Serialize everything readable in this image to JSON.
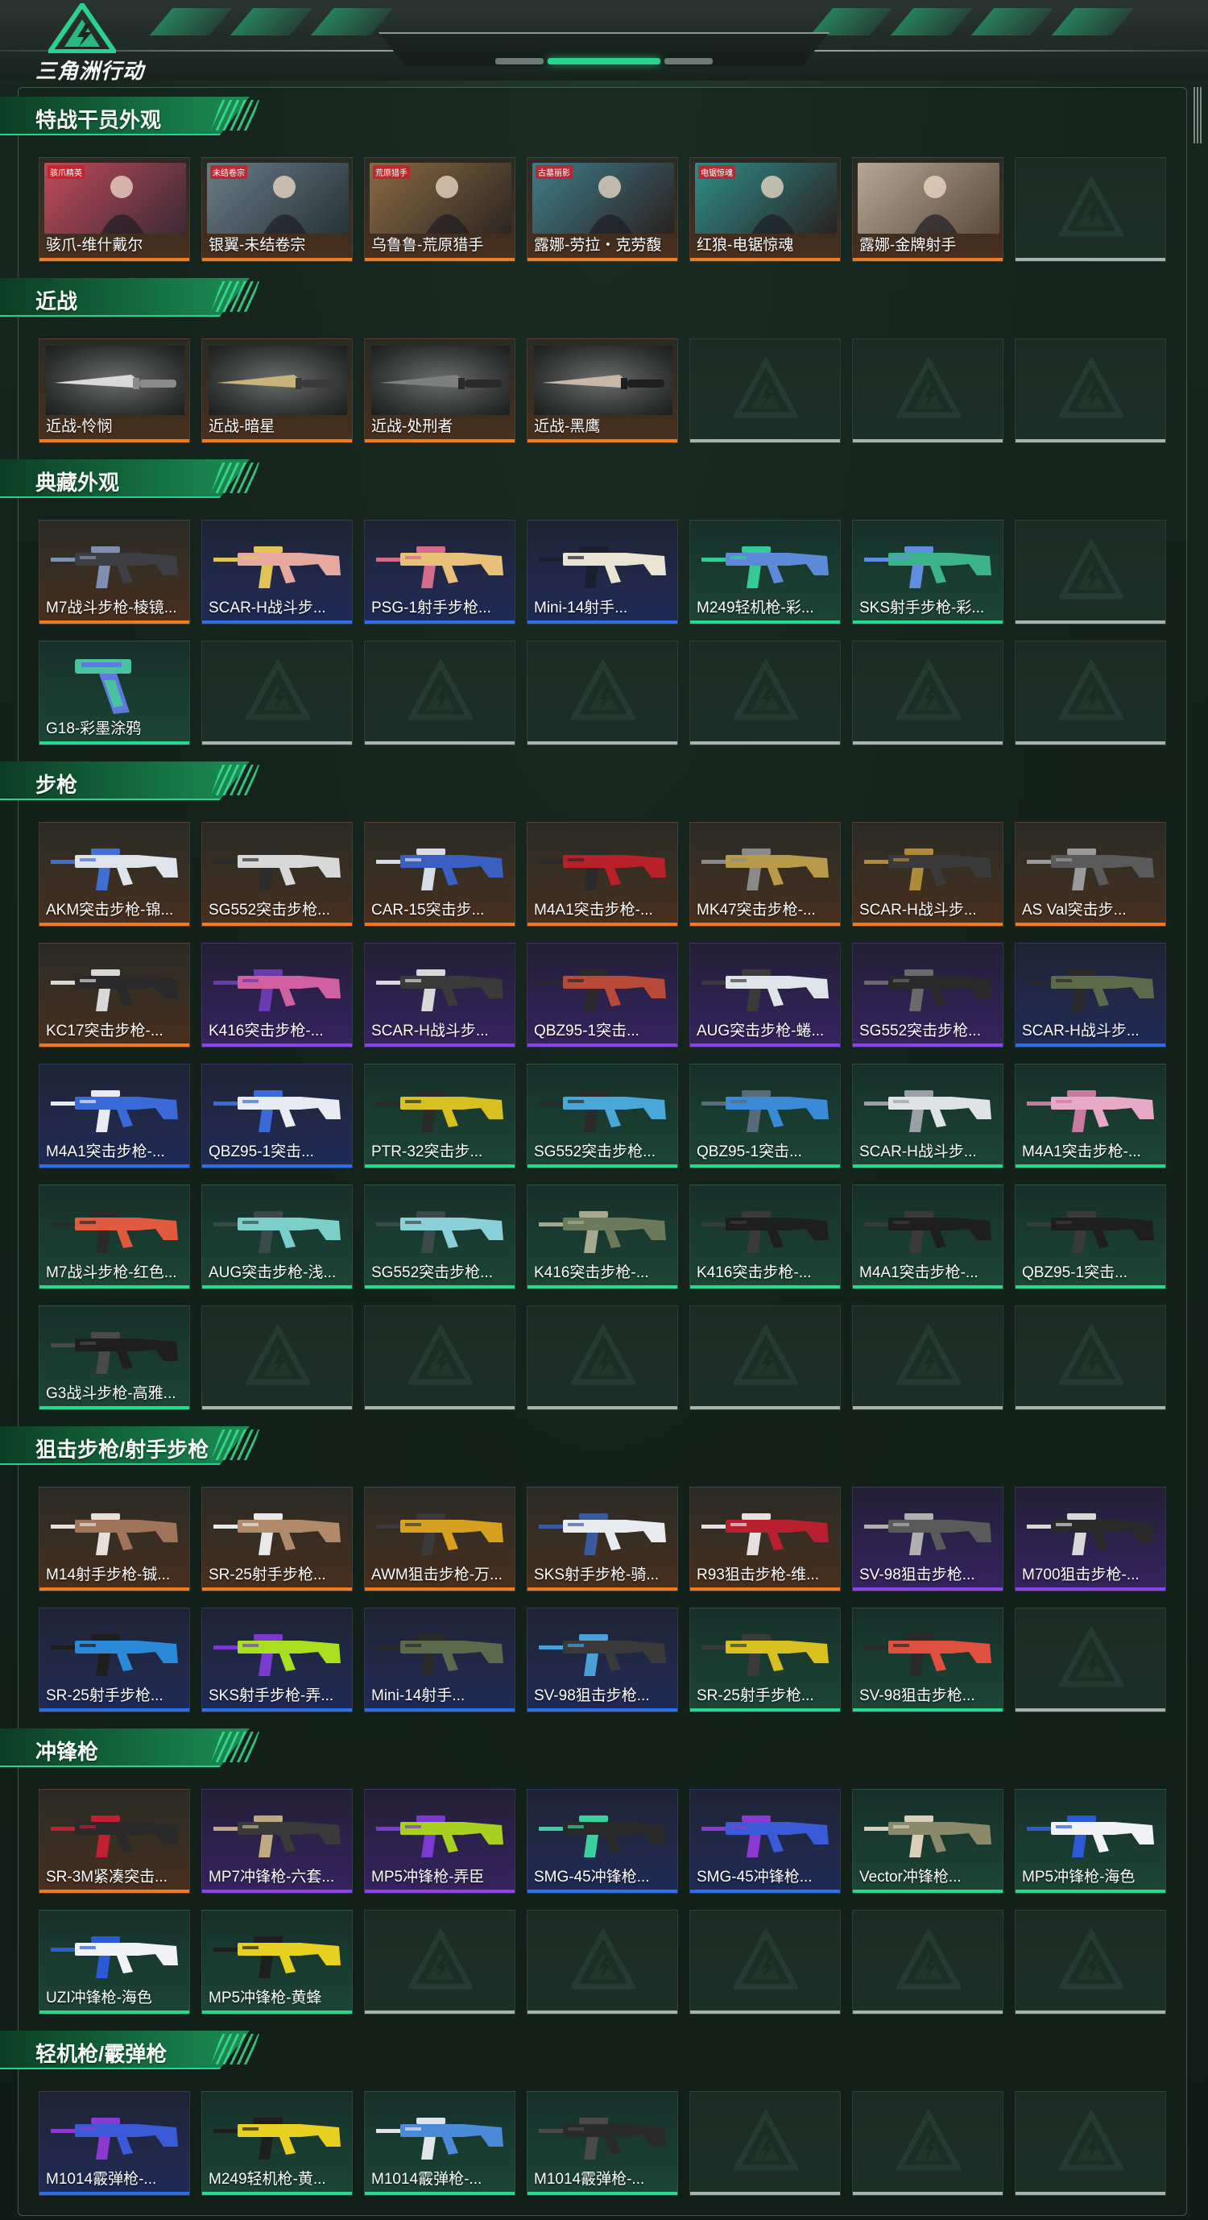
{
  "header": {
    "logo_text": "三角洲行动"
  },
  "sections": [
    {
      "title": "特战干员外观",
      "rows": [
        [
          {
            "name": "骇爪-维什戴尔",
            "rarity": "orange",
            "kind": "portrait",
            "colors": [
              "#c04a58",
              "#3b2a36"
            ],
            "tag": "骇爪精英"
          },
          {
            "name": "银翼-未结卷宗",
            "rarity": "orange",
            "kind": "portrait",
            "colors": [
              "#6a7c84",
              "#27323a"
            ],
            "tag": "未结卷宗"
          },
          {
            "name": "乌鲁鲁-荒原猎手",
            "rarity": "orange",
            "kind": "portrait",
            "colors": [
              "#8a6a44",
              "#2d2620"
            ],
            "tag": "荒原猎手"
          },
          {
            "name": "露娜-劳拉・克劳馥",
            "rarity": "orange",
            "kind": "portrait",
            "colors": [
              "#3f7c8a",
              "#2a2220"
            ],
            "tag": "古墓丽影"
          },
          {
            "name": "红狼-电锯惊魂",
            "rarity": "orange",
            "kind": "portrait",
            "colors": [
              "#2f8d88",
              "#2a2222"
            ],
            "tag": "电锯惊魂"
          },
          {
            "name": "露娜-金牌射手",
            "rarity": "orange",
            "kind": "portrait",
            "colors": [
              "#b7a693",
              "#5a4a3a"
            ],
            "tag": ""
          },
          {
            "empty": true
          }
        ]
      ]
    },
    {
      "title": "近战",
      "rows": [
        [
          {
            "name": "近战-怜悯",
            "rarity": "orange",
            "kind": "knife",
            "colors": [
              "#d9d9d9",
              "#8a8a8a"
            ]
          },
          {
            "name": "近战-暗星",
            "rarity": "orange",
            "kind": "knife",
            "colors": [
              "#c9b37a",
              "#3a3a3a"
            ]
          },
          {
            "name": "近战-处刑者",
            "rarity": "orange",
            "kind": "knife",
            "colors": [
              "#7d7f7e",
              "#2a2a2a"
            ]
          },
          {
            "name": "近战-黑鹰",
            "rarity": "orange",
            "kind": "knife",
            "colors": [
              "#c8b7a6",
              "#1e1e1e"
            ]
          },
          {
            "empty": true
          },
          {
            "empty": true
          },
          {
            "empty": true
          }
        ]
      ]
    },
    {
      "title": "典藏外观",
      "rows": [
        [
          {
            "name": "M7战斗步枪-棱镜...",
            "rarity": "orange",
            "kind": "gun",
            "colors": [
              "#3d3f45",
              "#7f8fb0"
            ]
          },
          {
            "name": "SCAR-H战斗步...",
            "rarity": "blue",
            "kind": "gun",
            "colors": [
              "#e7a8a0",
              "#e0c45a"
            ]
          },
          {
            "name": "PSG-1射手步枪...",
            "rarity": "blue",
            "kind": "gun",
            "colors": [
              "#e8c07a",
              "#d46b8a"
            ]
          },
          {
            "name": "Mini-14射手...",
            "rarity": "blue",
            "kind": "gun",
            "colors": [
              "#e9e3d2",
              "#1a1f30"
            ]
          },
          {
            "name": "M249轻机枪-彩...",
            "rarity": "green",
            "kind": "gun",
            "colors": [
              "#5d8ad8",
              "#35c99a"
            ]
          },
          {
            "name": "SKS射手步枪-彩...",
            "rarity": "green",
            "kind": "gun",
            "colors": [
              "#3cb38a",
              "#5f8ee0"
            ]
          },
          {
            "empty": true
          }
        ],
        [
          {
            "name": "G18-彩墨涂鸦",
            "rarity": "green",
            "kind": "pistol",
            "colors": [
              "#4ac1a0",
              "#5e79e0"
            ]
          },
          {
            "empty": true
          },
          {
            "empty": true
          },
          {
            "empty": true
          },
          {
            "empty": true
          },
          {
            "empty": true
          },
          {
            "empty": true
          }
        ]
      ]
    },
    {
      "title": "步枪",
      "rows": [
        [
          {
            "name": "AKM突击步枪-锦...",
            "rarity": "orange",
            "kind": "gun",
            "colors": [
              "#dfe3ea",
              "#3f6fd0"
            ]
          },
          {
            "name": "SG552突击步枪...",
            "rarity": "orange",
            "kind": "gun",
            "colors": [
              "#d8d8d8",
              "#2c2c2c"
            ]
          },
          {
            "name": "CAR-15突击步...",
            "rarity": "orange",
            "kind": "gun",
            "colors": [
              "#3a5fc0",
              "#d8dce8"
            ]
          },
          {
            "name": "M4A1突击步枪-...",
            "rarity": "orange",
            "kind": "gun",
            "colors": [
              "#b8202a",
              "#2a2a2a"
            ]
          },
          {
            "name": "MK47突击步枪-...",
            "rarity": "orange",
            "kind": "gun",
            "colors": [
              "#b89a4a",
              "#8a8a8a"
            ]
          },
          {
            "name": "SCAR-H战斗步...",
            "rarity": "orange",
            "kind": "gun",
            "colors": [
              "#3a3a3a",
              "#b08a3a"
            ]
          },
          {
            "name": "AS Val突击步...",
            "rarity": "orange",
            "kind": "gun",
            "colors": [
              "#5a5a5a",
              "#9a9a9a"
            ]
          }
        ],
        [
          {
            "name": "KC17突击步枪-...",
            "rarity": "orange",
            "kind": "gun",
            "colors": [
              "#2a2a2a",
              "#d8d8d8"
            ]
          },
          {
            "name": "K416突击步枪-...",
            "rarity": "purple",
            "kind": "gun",
            "colors": [
              "#d060a0",
              "#6a3ab0"
            ]
          },
          {
            "name": "SCAR-H战斗步...",
            "rarity": "purple",
            "kind": "gun",
            "colors": [
              "#3a3a3a",
              "#d8d8d8"
            ]
          },
          {
            "name": "QBZ95-1突击...",
            "rarity": "purple",
            "kind": "gun",
            "colors": [
              "#b84a3a",
              "#2a2a2a"
            ]
          },
          {
            "name": "AUG突击步枪-蜷...",
            "rarity": "purple",
            "kind": "gun",
            "colors": [
              "#dfe3ea",
              "#3a3a3a"
            ]
          },
          {
            "name": "SG552突击步枪...",
            "rarity": "purple",
            "kind": "gun",
            "colors": [
              "#2a2a2a",
              "#6a6a6a"
            ]
          },
          {
            "name": "SCAR-H战斗步...",
            "rarity": "blue",
            "kind": "gun",
            "colors": [
              "#5a6a4a",
              "#2a2a2a"
            ]
          }
        ],
        [
          {
            "name": "M4A1突击步枪-...",
            "rarity": "blue",
            "kind": "gun",
            "colors": [
              "#3a6ad8",
              "#e8ecf2"
            ]
          },
          {
            "name": "QBZ95-1突击...",
            "rarity": "blue",
            "kind": "gun",
            "colors": [
              "#e8ecf2",
              "#3a6ad8"
            ]
          },
          {
            "name": "PTR-32突击步...",
            "rarity": "green",
            "kind": "gun",
            "colors": [
              "#d8c020",
              "#2a2a2a"
            ]
          },
          {
            "name": "SG552突击步枪...",
            "rarity": "green",
            "kind": "gun",
            "colors": [
              "#4aa8d8",
              "#2a2a2a"
            ]
          },
          {
            "name": "QBZ95-1突击...",
            "rarity": "green",
            "kind": "gun",
            "colors": [
              "#3a8ad8",
              "#5a6a7a"
            ]
          },
          {
            "name": "SCAR-H战斗步...",
            "rarity": "green",
            "kind": "gun",
            "colors": [
              "#dfe3e5",
              "#9aa0a5"
            ]
          },
          {
            "name": "M4A1突击步枪-...",
            "rarity": "green",
            "kind": "gun",
            "colors": [
              "#e8a8c8",
              "#c87aa0"
            ]
          }
        ],
        [
          {
            "name": "M7战斗步枪-红色...",
            "rarity": "green",
            "kind": "gun",
            "colors": [
              "#e05a40",
              "#2a2a2a"
            ]
          },
          {
            "name": "AUG突击步枪-浅...",
            "rarity": "green",
            "kind": "gun",
            "colors": [
              "#7ad0c8",
              "#3a4a4a"
            ]
          },
          {
            "name": "SG552突击步枪...",
            "rarity": "green",
            "kind": "gun",
            "colors": [
              "#8ad0d8",
              "#3a4a4a"
            ]
          },
          {
            "name": "K416突击步枪-...",
            "rarity": "green",
            "kind": "gun",
            "colors": [
              "#6a7a5a",
              "#a8a890"
            ]
          },
          {
            "name": "K416突击步枪-...",
            "rarity": "green",
            "kind": "gun",
            "colors": [
              "#1e1e1e",
              "#3a3a3a"
            ]
          },
          {
            "name": "M4A1突击步枪-...",
            "rarity": "green",
            "kind": "gun",
            "colors": [
              "#1e1e1e",
              "#3a3a3a"
            ]
          },
          {
            "name": "QBZ95-1突击...",
            "rarity": "green",
            "kind": "gun",
            "colors": [
              "#1e1e1e",
              "#3a3a3a"
            ]
          }
        ],
        [
          {
            "name": "G3战斗步枪-高雅...",
            "rarity": "green",
            "kind": "gun",
            "colors": [
              "#1e1e1e",
              "#4a4a4a"
            ]
          },
          {
            "empty": true
          },
          {
            "empty": true
          },
          {
            "empty": true
          },
          {
            "empty": true
          },
          {
            "empty": true
          },
          {
            "empty": true
          }
        ]
      ]
    },
    {
      "title": "狙击步枪/射手步枪",
      "rows": [
        [
          {
            "name": "M14射手步枪-铖...",
            "rarity": "orange",
            "kind": "gun",
            "colors": [
              "#a0745a",
              "#e8e0d8"
            ]
          },
          {
            "name": "SR-25射手步枪...",
            "rarity": "orange",
            "kind": "gun",
            "colors": [
              "#b08a6a",
              "#e8e8e8"
            ]
          },
          {
            "name": "AWM狙击步枪-万...",
            "rarity": "orange",
            "kind": "gun",
            "colors": [
              "#d8a020",
              "#3a3a3a"
            ]
          },
          {
            "name": "SKS射手步枪-骑...",
            "rarity": "orange",
            "kind": "gun",
            "colors": [
              "#e8ecf0",
              "#3a5aa0"
            ]
          },
          {
            "name": "R93狙击步枪-维...",
            "rarity": "orange",
            "kind": "gun",
            "colors": [
              "#b82030",
              "#e8e0e0"
            ]
          },
          {
            "name": "SV-98狙击步枪...",
            "rarity": "purple",
            "kind": "gun",
            "colors": [
              "#5a5a5a",
              "#b0b0b0"
            ]
          },
          {
            "name": "M700狙击步枪-...",
            "rarity": "purple",
            "kind": "gun",
            "colors": [
              "#2a2a2a",
              "#d8d8d8"
            ]
          }
        ],
        [
          {
            "name": "SR-25射手步枪...",
            "rarity": "blue",
            "kind": "gun",
            "colors": [
              "#2a8ad8",
              "#1e1e1e"
            ]
          },
          {
            "name": "SKS射手步枪-弄...",
            "rarity": "blue",
            "kind": "gun",
            "colors": [
              "#a8e020",
              "#7a3ad0"
            ]
          },
          {
            "name": "Mini-14射手...",
            "rarity": "blue",
            "kind": "gun",
            "colors": [
              "#5a6a4a",
              "#2a2a2a"
            ]
          },
          {
            "name": "SV-98狙击步枪...",
            "rarity": "blue",
            "kind": "gun",
            "colors": [
              "#3a3a3a",
              "#4aa0d8"
            ]
          },
          {
            "name": "SR-25射手步枪...",
            "rarity": "green",
            "kind": "gun",
            "colors": [
              "#d8c020",
              "#3a3a3a"
            ]
          },
          {
            "name": "SV-98狙击步枪...",
            "rarity": "green",
            "kind": "gun",
            "colors": [
              "#e05040",
              "#2a2a2a"
            ]
          },
          {
            "empty": true
          }
        ]
      ]
    },
    {
      "title": "冲锋枪",
      "rows": [
        [
          {
            "name": "SR-3M紧凑突击...",
            "rarity": "orange",
            "kind": "gun",
            "colors": [
              "#2a2a2a",
              "#c02030"
            ]
          },
          {
            "name": "MP7冲锋枪-六套...",
            "rarity": "purple",
            "kind": "gun",
            "colors": [
              "#3a3a3a",
              "#c0a880"
            ]
          },
          {
            "name": "MP5冲锋枪-弄臣",
            "rarity": "purple",
            "kind": "gun",
            "colors": [
              "#a8d020",
              "#7a3ad0"
            ]
          },
          {
            "name": "SMG-45冲锋枪...",
            "rarity": "blue",
            "kind": "gun",
            "colors": [
              "#2a2a2a",
              "#3ad0a0"
            ]
          },
          {
            "name": "SMG-45冲锋枪...",
            "rarity": "blue",
            "kind": "gun",
            "colors": [
              "#3a5ad8",
              "#8a3ad0"
            ]
          },
          {
            "name": "Vector冲锋枪...",
            "rarity": "green",
            "kind": "gun",
            "colors": [
              "#8a8a6a",
              "#d8d0b8"
            ]
          },
          {
            "name": "MP5冲锋枪-海色",
            "rarity": "green",
            "kind": "gun",
            "colors": [
              "#f0f2f5",
              "#2a5ad8"
            ]
          }
        ],
        [
          {
            "name": "UZI冲锋枪-海色",
            "rarity": "green",
            "kind": "gun",
            "colors": [
              "#f0f2f5",
              "#2a5ad8"
            ]
          },
          {
            "name": "MP5冲锋枪-黄蜂",
            "rarity": "green",
            "kind": "gun",
            "colors": [
              "#e8d020",
              "#1e1e1e"
            ]
          },
          {
            "empty": true
          },
          {
            "empty": true
          },
          {
            "empty": true
          },
          {
            "empty": true
          },
          {
            "empty": true
          }
        ]
      ]
    },
    {
      "title": "轻机枪/霰弹枪",
      "rows": [
        [
          {
            "name": "M1014霰弹枪-...",
            "rarity": "blue",
            "kind": "gun",
            "colors": [
              "#3a5ad8",
              "#8a3ad0"
            ]
          },
          {
            "name": "M249轻机枪-黄...",
            "rarity": "green",
            "kind": "gun",
            "colors": [
              "#e8d020",
              "#1e1e1e"
            ]
          },
          {
            "name": "M1014霰弹枪-...",
            "rarity": "green",
            "kind": "gun",
            "colors": [
              "#4a8ad8",
              "#dfe3ea"
            ]
          },
          {
            "name": "M1014霰弹枪-...",
            "rarity": "green",
            "kind": "gun",
            "colors": [
              "#2a2a2a",
              "#4a4a4a"
            ]
          },
          {
            "empty": true
          },
          {
            "empty": true
          },
          {
            "empty": true
          }
        ]
      ]
    }
  ]
}
